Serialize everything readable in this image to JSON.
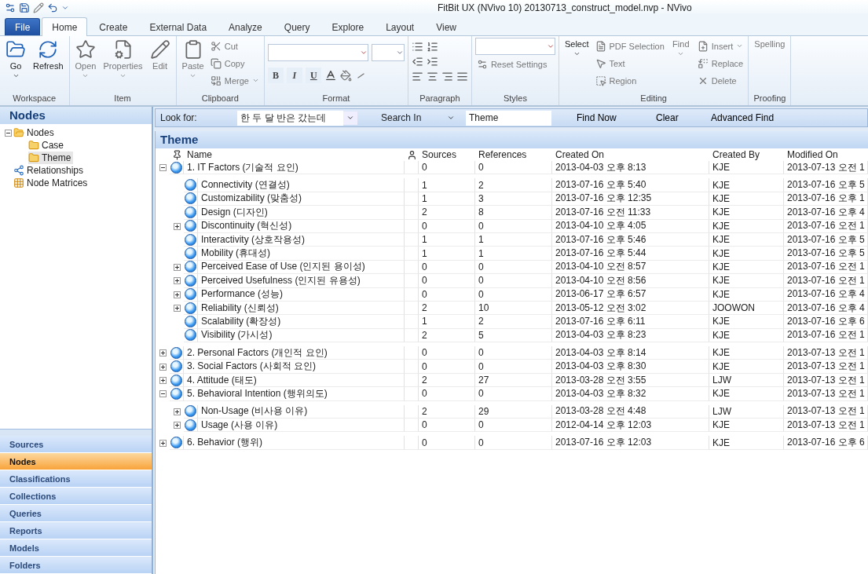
{
  "window": {
    "title": "FitBit UX (NVivo 10) 20130713_construct_model.nvp - NVivo"
  },
  "ribbon_tabs": [
    {
      "label": "File",
      "kind": "file",
      "selected": false
    },
    {
      "label": "Home",
      "kind": "tab",
      "selected": true
    },
    {
      "label": "Create",
      "kind": "tab",
      "selected": false
    },
    {
      "label": "External Data",
      "kind": "tab",
      "selected": false
    },
    {
      "label": "Analyze",
      "kind": "tab",
      "selected": false
    },
    {
      "label": "Query",
      "kind": "tab",
      "selected": false
    },
    {
      "label": "Explore",
      "kind": "tab",
      "selected": false
    },
    {
      "label": "Layout",
      "kind": "tab",
      "selected": false
    },
    {
      "label": "View",
      "kind": "tab",
      "selected": false
    }
  ],
  "ribbon_groups": [
    {
      "label": "Workspace",
      "items": [
        {
          "kind": "large",
          "label": "Go",
          "dropdown": true,
          "disabled": false
        },
        {
          "kind": "large",
          "label": "Refresh",
          "dropdown": false,
          "disabled": false
        }
      ]
    },
    {
      "label": "Item",
      "items": [
        {
          "kind": "large",
          "label": "Open",
          "dropdown": true,
          "disabled": true
        },
        {
          "kind": "large",
          "label": "Properties",
          "dropdown": true,
          "disabled": true
        },
        {
          "kind": "large",
          "label": "Edit",
          "dropdown": false,
          "disabled": true
        }
      ]
    },
    {
      "label": "Clipboard",
      "items": [
        {
          "kind": "large",
          "label": "Paste",
          "dropdown": true,
          "disabled": true
        },
        {
          "kind": "small",
          "label": "Cut",
          "dropdown": false,
          "disabled": true
        },
        {
          "kind": "small",
          "label": "Copy",
          "dropdown": false,
          "disabled": true
        },
        {
          "kind": "small",
          "label": "Merge",
          "dropdown": true,
          "disabled": true
        }
      ]
    },
    {
      "label": "Format",
      "items": [
        {
          "kind": "font",
          "buttons": [
            "B",
            "I",
            "U"
          ]
        }
      ]
    },
    {
      "label": "Paragraph",
      "items": [
        {
          "kind": "paragraph"
        }
      ]
    },
    {
      "label": "Styles",
      "items": [
        {
          "kind": "combo"
        },
        {
          "kind": "small",
          "label": "Reset Settings",
          "dropdown": false,
          "disabled": true
        }
      ]
    },
    {
      "label": "Editing",
      "items": [
        {
          "kind": "large",
          "label": "Select",
          "dropdown": true,
          "disabled": false
        },
        {
          "kind": "small",
          "label": "PDF Selection",
          "dropdown": false,
          "disabled": true
        },
        {
          "kind": "small",
          "label": "Text",
          "dropdown": false,
          "disabled": true
        },
        {
          "kind": "small",
          "label": "Region",
          "dropdown": false,
          "disabled": true
        },
        {
          "kind": "large",
          "label": "Find",
          "dropdown": true,
          "disabled": true
        },
        {
          "kind": "small",
          "label": "Insert",
          "dropdown": true,
          "disabled": true
        },
        {
          "kind": "small",
          "label": "Replace",
          "dropdown": false,
          "disabled": true
        },
        {
          "kind": "small",
          "label": "Delete",
          "dropdown": false,
          "disabled": true
        }
      ]
    },
    {
      "label": "Proofing",
      "items": [
        {
          "kind": "large",
          "label": "Spelling",
          "dropdown": false,
          "disabled": true
        }
      ]
    }
  ],
  "navigation": {
    "title": "Nodes",
    "tree": [
      {
        "label": "Nodes",
        "kind": "open-folder",
        "expanded": true,
        "selected": false,
        "children": [
          {
            "label": "Case",
            "kind": "folder",
            "selected": false
          },
          {
            "label": "Theme",
            "kind": "folder",
            "selected": true
          }
        ]
      },
      {
        "label": "Relationships",
        "kind": "relationships",
        "selected": false
      },
      {
        "label": "Node Matrices",
        "kind": "matrices",
        "selected": false
      }
    ],
    "sections": [
      {
        "label": "Sources",
        "selected": false
      },
      {
        "label": "Nodes",
        "selected": true
      },
      {
        "label": "Classifications",
        "selected": false
      },
      {
        "label": "Collections",
        "selected": false
      },
      {
        "label": "Queries",
        "selected": false
      },
      {
        "label": "Reports",
        "selected": false
      },
      {
        "label": "Models",
        "selected": false
      },
      {
        "label": "Folders",
        "selected": false
      }
    ]
  },
  "find_bar": {
    "look_for_label": "Look for:",
    "look_for_value": "한 두 달 반은 갔는데",
    "search_in_label": "Search In",
    "search_in_value": "Theme",
    "buttons": [
      "Find Now",
      "Clear",
      "Advanced Find"
    ]
  },
  "content": {
    "title": "Theme",
    "columns": [
      "Name",
      "Sources",
      "References",
      "Created On",
      "Created By",
      "Modified On"
    ],
    "rows": [
      {
        "name": "1. IT Factors (기술적 요인)",
        "sources": "0",
        "references": "0",
        "created_on": "2013-04-03 오후 8:13",
        "created_by": "KJE",
        "modified_on": "2013-07-13 오전 1",
        "expanded": true,
        "children": [
          {
            "name": "Connectivity (연결성)",
            "sources": "1",
            "references": "2",
            "created_on": "2013-07-16 오후 5:40",
            "created_by": "KJE",
            "modified_on": "2013-07-16 오후 5"
          },
          {
            "name": "Customizability (맞춤성)",
            "sources": "1",
            "references": "3",
            "created_on": "2013-07-16 오후 12:35",
            "created_by": "KJE",
            "modified_on": "2013-07-16 오후 1"
          },
          {
            "name": "Design (디자인)",
            "sources": "2",
            "references": "8",
            "created_on": "2013-07-16 오전 11:33",
            "created_by": "KJE",
            "modified_on": "2013-07-16 오후 4"
          },
          {
            "name": "Discontinuity (혁신성)",
            "sources": "0",
            "references": "0",
            "created_on": "2013-04-10 오후 4:05",
            "created_by": "KJE",
            "modified_on": "2013-07-16 오전 1",
            "expanded": false
          },
          {
            "name": "Interactivity (상호작용성)",
            "sources": "1",
            "references": "1",
            "created_on": "2013-07-16 오후 5:46",
            "created_by": "KJE",
            "modified_on": "2013-07-16 오후 5"
          },
          {
            "name": "Mobility (휴대성)",
            "sources": "1",
            "references": "1",
            "created_on": "2013-07-16 오후 5:44",
            "created_by": "KJE",
            "modified_on": "2013-07-16 오후 5"
          },
          {
            "name": "Perceived Ease of Use (인지된 용이성)",
            "sources": "0",
            "references": "0",
            "created_on": "2013-04-10 오전 8:57",
            "created_by": "KJE",
            "modified_on": "2013-07-16 오전 1",
            "expanded": false
          },
          {
            "name": "Perceived Usefulness (인지된 유용성)",
            "sources": "0",
            "references": "0",
            "created_on": "2013-04-10 오전 8:56",
            "created_by": "KJE",
            "modified_on": "2013-07-16 오전 1",
            "expanded": false
          },
          {
            "name": "Performance (성능)",
            "sources": "0",
            "references": "0",
            "created_on": "2013-06-17 오후 6:57",
            "created_by": "KJE",
            "modified_on": "2013-07-16 오후 4",
            "expanded": false
          },
          {
            "name": "Reliability (신뢰성)",
            "sources": "2",
            "references": "10",
            "created_on": "2013-05-12 오전 3:02",
            "created_by": "JOOWON",
            "modified_on": "2013-07-16 오후 4",
            "expanded": false
          },
          {
            "name": "Scalability (확장성)",
            "sources": "1",
            "references": "2",
            "created_on": "2013-07-16 오후 6:11",
            "created_by": "KJE",
            "modified_on": "2013-07-16 오후 6"
          },
          {
            "name": "Visibility (가시성)",
            "sources": "2",
            "references": "5",
            "created_on": "2013-04-03 오후 8:23",
            "created_by": "KJE",
            "modified_on": "2013-07-16 오전 1"
          }
        ]
      },
      {
        "name": "2. Personal Factors (개인적 요인)",
        "sources": "0",
        "references": "0",
        "created_on": "2013-04-03 오후 8:14",
        "created_by": "KJE",
        "modified_on": "2013-07-13 오전 1",
        "expanded": false
      },
      {
        "name": "3. Social Factors (사회적 요인)",
        "sources": "0",
        "references": "0",
        "created_on": "2013-04-03 오후 8:30",
        "created_by": "KJE",
        "modified_on": "2013-07-13 오전 1",
        "expanded": false
      },
      {
        "name": "4. Attitude (태도)",
        "sources": "2",
        "references": "27",
        "created_on": "2013-03-28 오전 3:55",
        "created_by": "LJW",
        "modified_on": "2013-07-13 오전 1",
        "expanded": false
      },
      {
        "name": "5. Behavioral Intention (행위의도)",
        "sources": "0",
        "references": "0",
        "created_on": "2013-04-03 오후 8:32",
        "created_by": "KJE",
        "modified_on": "2013-07-13 오전 1",
        "expanded": true,
        "children": [
          {
            "name": "Non-Usage (비사용 이유)",
            "sources": "2",
            "references": "29",
            "created_on": "2013-03-28 오전 4:48",
            "created_by": "LJW",
            "modified_on": "2013-07-13 오전 1",
            "expanded": false
          },
          {
            "name": "Usage (사용 이유)",
            "sources": "0",
            "references": "0",
            "created_on": "2012-04-14 오후 12:03",
            "created_by": "KJE",
            "modified_on": "2013-07-13 오전 1",
            "expanded": false
          }
        ]
      },
      {
        "name": "6. Behavior (행위)",
        "sources": "0",
        "references": "0",
        "created_on": "2013-07-16 오후 12:03",
        "created_by": "KJE",
        "modified_on": "2013-07-16 오후 6",
        "expanded": false
      }
    ]
  }
}
